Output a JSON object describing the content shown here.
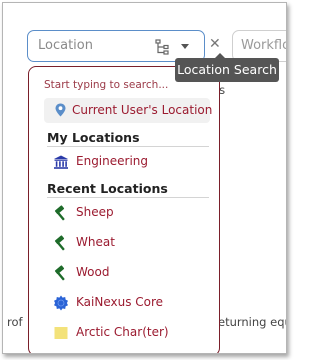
{
  "location_search": {
    "placeholder": "Location",
    "tooltip": "Location Search"
  },
  "workflow_field": {
    "placeholder": "Workflo"
  },
  "background_snippets": {
    "right_fragment": "es",
    "bottom_left": "rof",
    "bottom_right": "eturning equi"
  },
  "dropdown": {
    "hint": "Start typing to search...",
    "current_user": "Current User's Location",
    "sections": {
      "my_locations": "My Locations",
      "recent_locations": "Recent Locations"
    },
    "my_locations": [
      {
        "label": "Engineering",
        "icon": "building-icon"
      }
    ],
    "recent_locations": [
      {
        "label": "Sheep",
        "icon": "hammer-icon"
      },
      {
        "label": "Wheat",
        "icon": "hammer-icon"
      },
      {
        "label": "Wood",
        "icon": "hammer-icon"
      },
      {
        "label": "KaiNexus Core",
        "icon": "badge-icon"
      },
      {
        "label": "Arctic Char(ter)",
        "icon": "square-icon"
      }
    ]
  },
  "colors": {
    "accent": "#9b1b30",
    "dropdown_border": "#7a1f2a",
    "input_border": "#5b8ec9",
    "tooltip_bg": "#555555",
    "pin": "#5b8ec9",
    "building": "#2a3aa8",
    "hammer": "#1e6b2a",
    "badge": "#2a63d6",
    "square": "#f3e27a"
  }
}
